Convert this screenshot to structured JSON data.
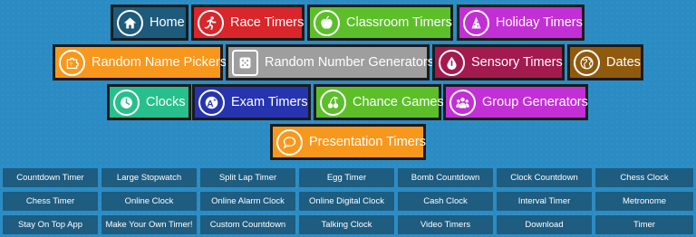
{
  "categories": {
    "home": {
      "label": "Home",
      "color": "#1d5a7c",
      "icon": "home-icon"
    },
    "race": {
      "label": "Race Timers",
      "color": "#d8262b",
      "icon": "runner-icon"
    },
    "classroom": {
      "label": "Classroom Timers",
      "color": "#5cbf2a",
      "icon": "apple-icon"
    },
    "holiday": {
      "label": "Holiday Timers",
      "color": "#c22fd4",
      "icon": "party-hat-icon"
    },
    "random_name": {
      "label": "Random Name Pickers",
      "color": "#f7981d",
      "icon": "puzzle-icon"
    },
    "random_number": {
      "label": "Random Number Generators",
      "color": "#9e9e9e",
      "icon": "dice-icon"
    },
    "sensory": {
      "label": "Sensory Timers",
      "color": "#a31a4f",
      "icon": "droplet-icon"
    },
    "dates": {
      "label": "Dates",
      "color": "#8f5a0e",
      "icon": "globe-icon"
    },
    "clocks": {
      "label": "Clocks",
      "color": "#27bf8c",
      "icon": "clock-icon"
    },
    "exam": {
      "label": "Exam Timers",
      "color": "#2634b0",
      "icon": "grade-a-plus-icon"
    },
    "chance": {
      "label": "Chance Games",
      "color": "#5cbf2a",
      "icon": "cherries-icon"
    },
    "group": {
      "label": "Group Generators",
      "color": "#c22fd4",
      "icon": "people-icon"
    },
    "presentation": {
      "label": "Presentation Timers",
      "color": "#f7981d",
      "icon": "speech-bubble-icon"
    }
  },
  "links": [
    [
      "Countdown Timer",
      "Large Stopwatch",
      "Split Lap Timer",
      "Egg Timer",
      "Bomb Countdown",
      "Clock Countdown",
      "Chess Clock"
    ],
    [
      "Chess Timer",
      "Online Clock",
      "Online Alarm Clock",
      "Online Digital Clock",
      "Cash Clock",
      "Interval Timer",
      "Metronome"
    ],
    [
      "Stay On Top App",
      "Make Your Own Timer!",
      "Custom Countdown",
      "Talking Clock",
      "Video Timers",
      "Download",
      "Timer"
    ]
  ]
}
